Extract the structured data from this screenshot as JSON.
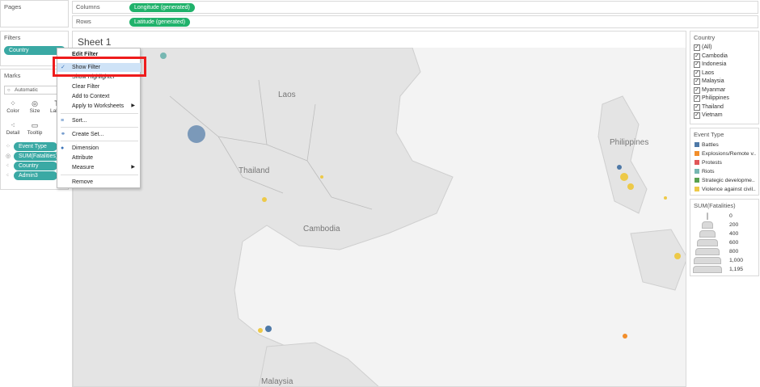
{
  "pages": {
    "title": "Pages"
  },
  "filters": {
    "title": "Filters",
    "pill": "Country"
  },
  "marks": {
    "title": "Marks",
    "mark_type": "Automatic",
    "buttons": [
      {
        "label": "Color",
        "icon": "color-icon"
      },
      {
        "label": "Size",
        "icon": "size-icon"
      },
      {
        "label": "Label",
        "icon": "label-icon"
      },
      {
        "label": "Detail",
        "icon": "detail-icon"
      },
      {
        "label": "Tooltip",
        "icon": "tooltip-icon"
      }
    ],
    "pills": [
      "Event Type",
      "SUM(Fatalities)",
      "Country",
      "Admin3"
    ]
  },
  "shelves": {
    "columns": {
      "label": "Columns",
      "pill": "Longitude (generated)"
    },
    "rows": {
      "label": "Rows",
      "pill": "Latitude (generated)"
    }
  },
  "sheet": {
    "title": "Sheet 1"
  },
  "map": {
    "labels": [
      "Laos",
      "Thailand",
      "Cambodia",
      "Philippines",
      "Malaysia"
    ]
  },
  "context_menu": {
    "items": [
      "Edit Filter",
      "Show Filter",
      "Show Highlighter",
      "Clear Filter",
      "Add to Context",
      "Apply to Worksheets",
      "Sort...",
      "Create Set...",
      "Dimension",
      "Attribute",
      "Measure",
      "Remove"
    ],
    "highlighted": "Show Filter"
  },
  "country_legend": {
    "title": "Country",
    "items": [
      "(All)",
      "Cambodia",
      "Indonesia",
      "Laos",
      "Malaysia",
      "Myanmar",
      "Philippines",
      "Thailand",
      "Vietnam"
    ]
  },
  "event_legend": {
    "title": "Event Type",
    "items": [
      {
        "label": "Battles",
        "color": "#4e79a7"
      },
      {
        "label": "Explosions/Remote v..",
        "color": "#f28e2b"
      },
      {
        "label": "Protests",
        "color": "#e15759"
      },
      {
        "label": "Riots",
        "color": "#76b7b2"
      },
      {
        "label": "Strategic developme..",
        "color": "#59a14f"
      },
      {
        "label": "Violence against civil..",
        "color": "#edc948"
      }
    ]
  },
  "size_legend": {
    "title": "SUM(Fatalities)",
    "values": [
      "0",
      "200",
      "400",
      "600",
      "800",
      "1,000",
      "1,195"
    ]
  },
  "colors": {
    "pill_teal": "#3aa9a4",
    "pill_green": "#20b26b",
    "highlight": "#cfe3f7",
    "red_box": "#ee1c1c"
  }
}
